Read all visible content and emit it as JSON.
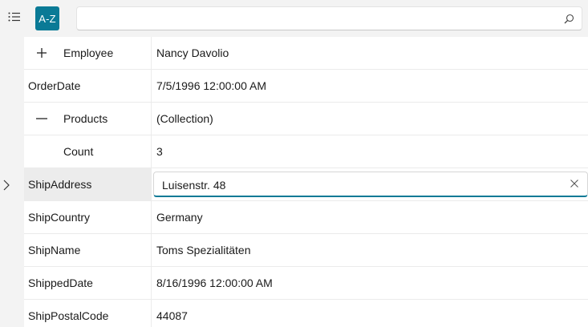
{
  "toolbar": {
    "categorize_icon": "list-icon",
    "sort_label": "A-Z",
    "search": {
      "value": "",
      "icon": "search-icon"
    }
  },
  "accent_color": "#0a7a96",
  "rows": [
    {
      "name": "Employee",
      "value": "Nancy Davolio",
      "expander": "plus"
    },
    {
      "name": "OrderDate",
      "value": "7/5/1996 12:00:00 AM"
    },
    {
      "name": "Products",
      "value": "(Collection)",
      "expander": "minus"
    },
    {
      "name": "Count",
      "value": "3"
    },
    {
      "name": "ShipAddress",
      "value": "Luisenstr. 48",
      "selected": true,
      "editing": true
    },
    {
      "name": "ShipCountry",
      "value": "Germany"
    },
    {
      "name": "ShipName",
      "value": "Toms Spezialitäten"
    },
    {
      "name": "ShippedDate",
      "value": "8/16/1996 12:00:00 AM"
    },
    {
      "name": "ShipPostalCode",
      "value": "44087"
    }
  ]
}
